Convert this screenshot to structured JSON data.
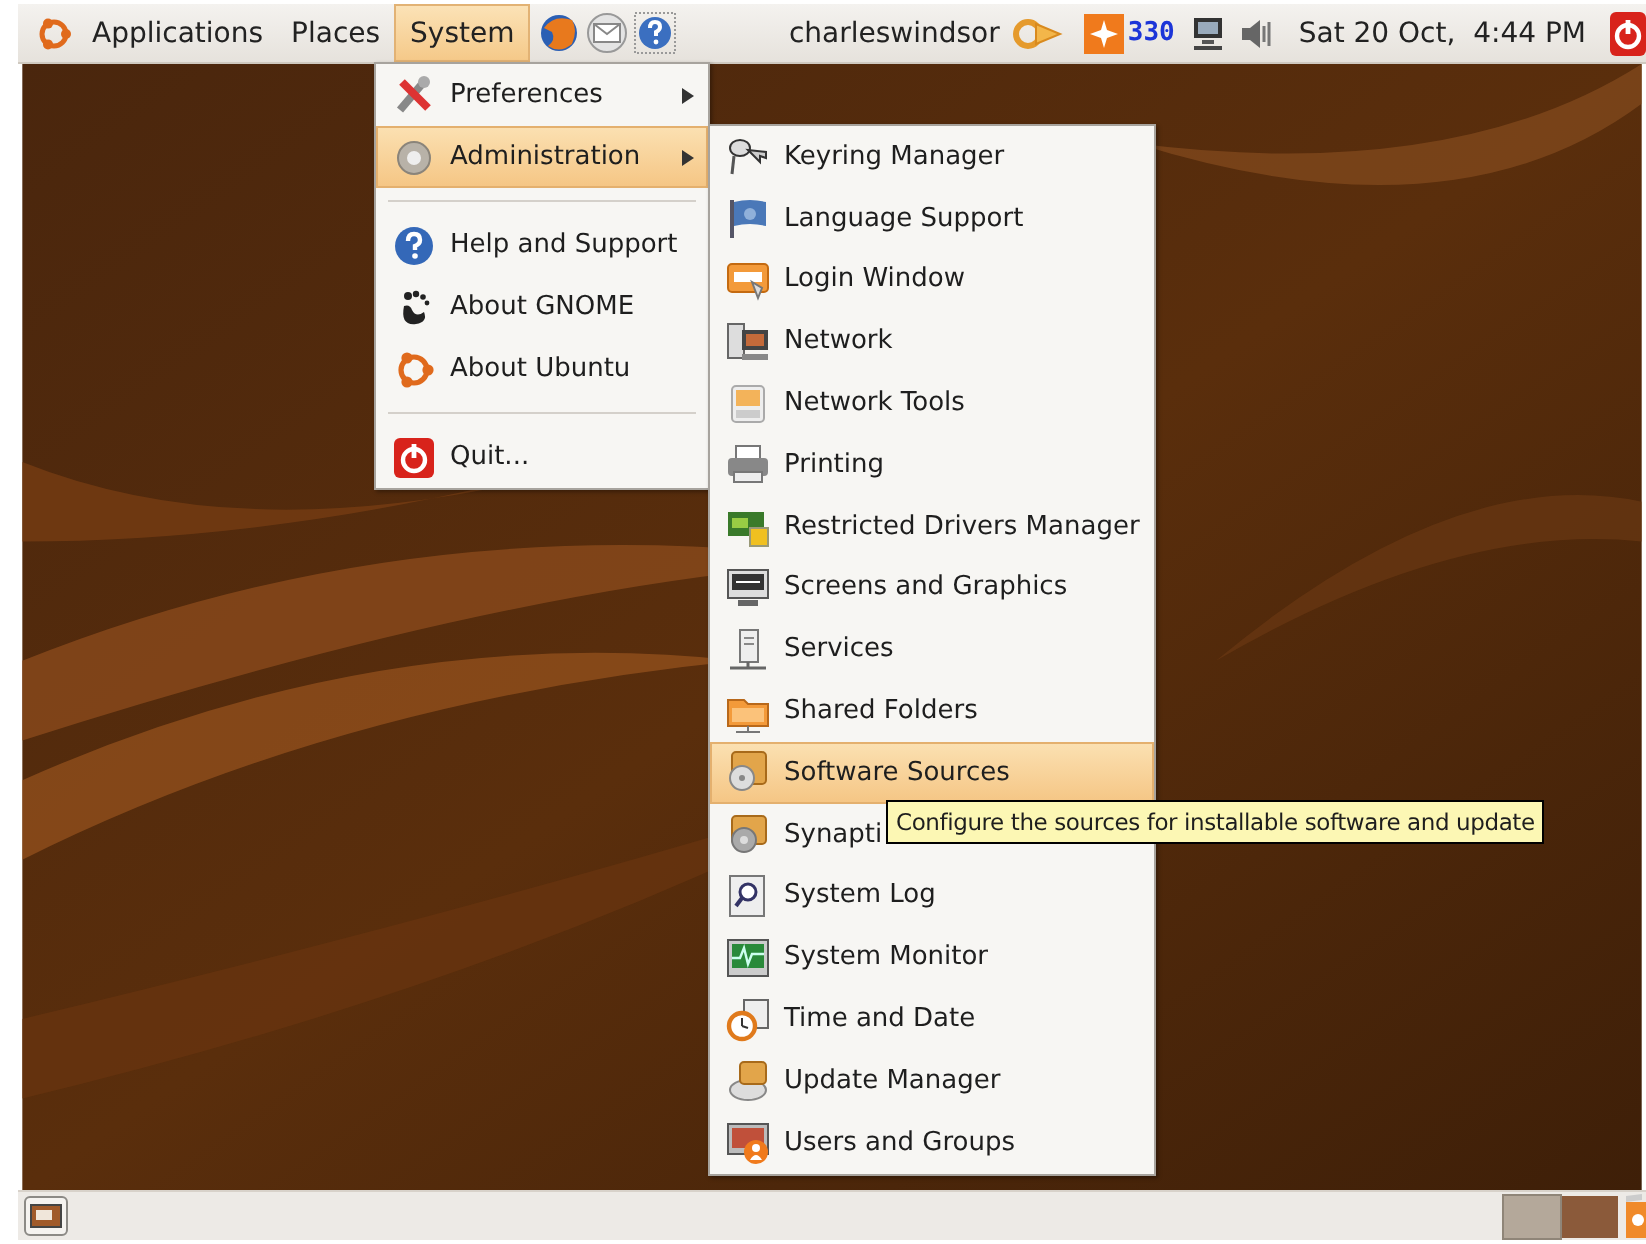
{
  "top_panel": {
    "menus": [
      {
        "label": "Applications",
        "selected": false
      },
      {
        "label": "Places",
        "selected": false
      },
      {
        "label": "System",
        "selected": true
      }
    ],
    "user": "charleswindsor",
    "notification_count": "330",
    "clock": "Sat 20 Oct,  4:44 PM"
  },
  "system_menu": {
    "items": [
      {
        "kind": "item",
        "label": "Preferences",
        "submenu": true,
        "selected": false
      },
      {
        "kind": "item",
        "label": "Administration",
        "submenu": true,
        "selected": true
      },
      {
        "kind": "separator"
      },
      {
        "kind": "item",
        "label": "Help and Support",
        "submenu": false,
        "selected": false
      },
      {
        "kind": "item",
        "label": "About GNOME",
        "submenu": false,
        "selected": false
      },
      {
        "kind": "item",
        "label": "About Ubuntu",
        "submenu": false,
        "selected": false
      },
      {
        "kind": "separator"
      },
      {
        "kind": "item",
        "label": "Quit...",
        "submenu": false,
        "selected": false
      }
    ]
  },
  "administration_menu": {
    "items": [
      {
        "label": "Keyring Manager",
        "selected": false
      },
      {
        "label": "Language Support",
        "selected": false
      },
      {
        "label": "Login Window",
        "selected": false
      },
      {
        "label": "Network",
        "selected": false
      },
      {
        "label": "Network Tools",
        "selected": false
      },
      {
        "label": "Printing",
        "selected": false
      },
      {
        "label": "Restricted Drivers Manager",
        "selected": false
      },
      {
        "label": "Screens and Graphics",
        "selected": false
      },
      {
        "label": "Services",
        "selected": false
      },
      {
        "label": "Shared Folders",
        "selected": false
      },
      {
        "label": "Software Sources",
        "selected": true
      },
      {
        "label": "Synapti",
        "selected": false
      },
      {
        "label": "System Log",
        "selected": false
      },
      {
        "label": "System Monitor",
        "selected": false
      },
      {
        "label": "Time and Date",
        "selected": false
      },
      {
        "label": "Update Manager",
        "selected": false
      },
      {
        "label": "Users and Groups",
        "selected": false
      }
    ]
  },
  "tooltip": "Configure the sources for installable software and update",
  "bottom_panel": {
    "workspaces": [
      {
        "selected": true
      },
      {
        "selected": false
      }
    ]
  }
}
